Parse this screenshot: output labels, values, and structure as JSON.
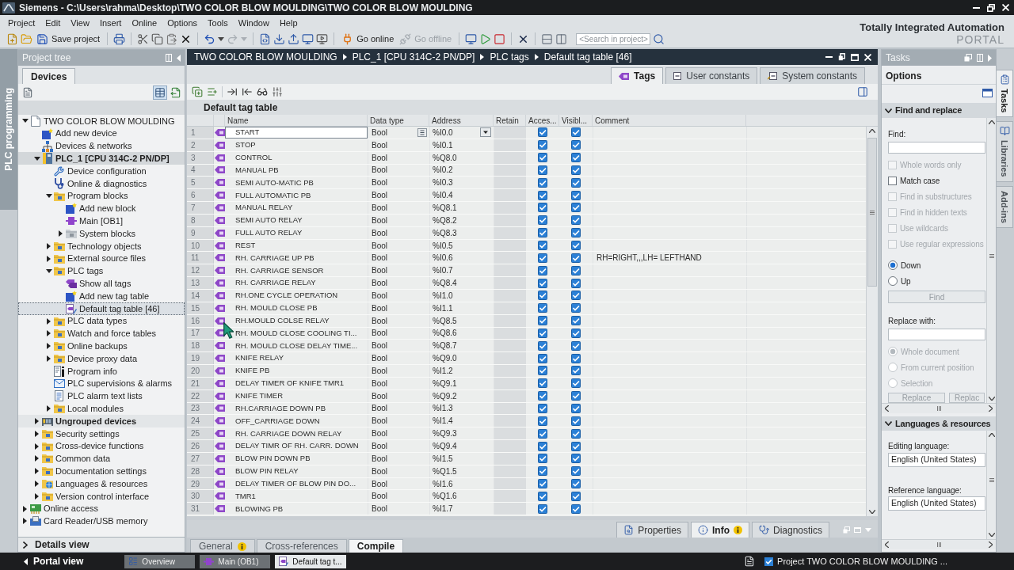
{
  "title_bar": {
    "title": "Siemens - C:\\Users\\rahma\\Desktop\\TWO COLOR BLOW MOULDING\\TWO COLOR BLOW MOULDING"
  },
  "menu": [
    "Project",
    "Edit",
    "View",
    "Insert",
    "Online",
    "Options",
    "Tools",
    "Window",
    "Help"
  ],
  "brand": {
    "line_1": "Totally Integrated Automation",
    "line_2": "PORTAL"
  },
  "toolbar": {
    "save": {
      "label": "Save project"
    },
    "go_online": {
      "label": "Go online",
      "disabled": false
    },
    "go_offline": {
      "label": "Go offline",
      "disabled": true
    },
    "search": {
      "placeholder": "<Search in project>"
    }
  },
  "side_tab": {
    "label": "PLC programming"
  },
  "project_tree": {
    "title": "Project tree",
    "tabs": [
      {
        "label": "Devices",
        "selected": true
      }
    ],
    "items": [
      {
        "label": "TWO COLOR BLOW MOULDING",
        "kind": "project",
        "expanded": true,
        "selected": false,
        "children": [
          {
            "label": "Add new device",
            "kind": "add",
            "selected": false
          },
          {
            "label": "Devices & networks",
            "kind": "network",
            "selected": false
          },
          {
            "label": "PLC_1 [CPU 314C-2 PN/DP]",
            "kind": "cpu",
            "expanded": true,
            "selected": false,
            "children": [
              {
                "label": "Device configuration",
                "kind": "config",
                "selected": false
              },
              {
                "label": "Online & diagnostics",
                "kind": "diagnostics",
                "selected": false
              },
              {
                "label": "Program blocks",
                "kind": "folder",
                "expanded": true,
                "selected": false,
                "children": [
                  {
                    "label": "Add new block",
                    "kind": "add",
                    "selected": false
                  },
                  {
                    "label": "Main [OB1]",
                    "kind": "block",
                    "selected": false
                  },
                  {
                    "label": "System blocks",
                    "kind": "system_folder",
                    "expanded": false,
                    "selected": false
                  }
                ]
              },
              {
                "label": "Technology objects",
                "kind": "folder",
                "expanded": false,
                "selected": false
              },
              {
                "label": "External source files",
                "kind": "folder",
                "expanded": false,
                "selected": false
              },
              {
                "label": "PLC tags",
                "kind": "folder",
                "expanded": true,
                "selected": false,
                "children": [
                  {
                    "label": "Show all tags",
                    "kind": "tags",
                    "selected": false
                  },
                  {
                    "label": "Add new tag table",
                    "kind": "add",
                    "selected": false
                  },
                  {
                    "label": "Default tag table [46]",
                    "kind": "table",
                    "selected": true
                  }
                ]
              },
              {
                "label": "PLC data types",
                "kind": "folder",
                "expanded": false,
                "selected": false
              },
              {
                "label": "Watch and force tables",
                "kind": "folder",
                "expanded": false,
                "selected": false
              },
              {
                "label": "Online backups",
                "kind": "folder",
                "expanded": false,
                "selected": false
              },
              {
                "label": "Device proxy data",
                "kind": "folder",
                "expanded": false,
                "selected": false
              },
              {
                "label": "Program info",
                "kind": "info",
                "selected": false
              },
              {
                "label": "PLC supervisions & alarms",
                "kind": "alarm",
                "selected": false
              },
              {
                "label": "PLC alarm text lists",
                "kind": "list",
                "selected": false
              },
              {
                "label": "Local modules",
                "kind": "folder",
                "expanded": false,
                "selected": false
              }
            ]
          },
          {
            "label": "Ungrouped devices",
            "kind": "devices",
            "expanded": false,
            "selected": false
          },
          {
            "label": "Security settings",
            "kind": "folder",
            "expanded": false,
            "selected": false
          },
          {
            "label": "Cross-device functions",
            "kind": "folder",
            "expanded": false,
            "selected": false
          },
          {
            "label": "Common data",
            "kind": "folder",
            "expanded": false,
            "selected": false
          },
          {
            "label": "Documentation settings",
            "kind": "folder",
            "expanded": false,
            "selected": false
          },
          {
            "label": "Languages & resources",
            "kind": "globe",
            "expanded": false,
            "selected": false
          },
          {
            "label": "Version control interface",
            "kind": "folder",
            "expanded": false,
            "selected": false
          }
        ]
      },
      {
        "label": "Online access",
        "kind": "access",
        "expanded": false,
        "selected": false
      },
      {
        "label": "Card Reader/USB memory",
        "kind": "card",
        "expanded": false,
        "selected": false
      }
    ],
    "details_view": {
      "label": "Details view",
      "expanded": false
    }
  },
  "editor": {
    "breadcrumb": [
      "TWO COLOR BLOW MOULDING",
      "PLC_1 [CPU 314C-2 PN/DP]",
      "PLC tags",
      "Default tag table [46]"
    ],
    "tabs": [
      {
        "label": "Tags",
        "selected": true
      },
      {
        "label": "User constants",
        "selected": false
      },
      {
        "label": "System constants",
        "selected": false
      }
    ],
    "table_title": "Default tag table",
    "table": {
      "columns": [
        "Name",
        "Data type",
        "Address",
        "Retain",
        "Acces...",
        "Visibl...",
        "Comment"
      ],
      "rows": [
        {
          "number": "1",
          "name": "START",
          "data_type": "Bool",
          "address": "%I0.0",
          "accessible": true,
          "visible": true,
          "selected": true
        },
        {
          "number": "2",
          "name": "STOP",
          "data_type": "Bool",
          "address": "%I0.1",
          "accessible": true,
          "visible": true,
          "selected": false
        },
        {
          "number": "3",
          "name": "CONTROL",
          "data_type": "Bool",
          "address": "%Q8.0",
          "accessible": true,
          "visible": true,
          "selected": false
        },
        {
          "number": "4",
          "name": "MANUAL PB",
          "data_type": "Bool",
          "address": "%I0.2",
          "accessible": true,
          "visible": true,
          "selected": false
        },
        {
          "number": "5",
          "name": "SEMI AUTO-MATIC PB",
          "data_type": "Bool",
          "address": "%I0.3",
          "accessible": true,
          "visible": true,
          "selected": false
        },
        {
          "number": "6",
          "name": "FULL AUTOMATIC PB",
          "data_type": "Bool",
          "address": "%I0.4",
          "accessible": true,
          "visible": true,
          "selected": false
        },
        {
          "number": "7",
          "name": "MANUAL RELAY",
          "data_type": "Bool",
          "address": "%Q8.1",
          "accessible": true,
          "visible": true,
          "selected": false
        },
        {
          "number": "8",
          "name": "SEMI AUTO RELAY",
          "data_type": "Bool",
          "address": "%Q8.2",
          "accessible": true,
          "visible": true,
          "selected": false
        },
        {
          "number": "9",
          "name": "FULL AUTO RELAY",
          "data_type": "Bool",
          "address": "%Q8.3",
          "accessible": true,
          "visible": true,
          "selected": false
        },
        {
          "number": "10",
          "name": "REST",
          "data_type": "Bool",
          "address": "%I0.5",
          "accessible": true,
          "visible": true,
          "selected": false
        },
        {
          "number": "11",
          "name": "RH. CARRIAGE UP PB",
          "data_type": "Bool",
          "address": "%I0.6",
          "accessible": true,
          "visible": true,
          "comment": "RH=RIGHT,,,LH= LEFTHAND",
          "selected": false
        },
        {
          "number": "12",
          "name": "RH. CARRIAGE SENSOR",
          "data_type": "Bool",
          "address": "%I0.7",
          "accessible": true,
          "visible": true,
          "selected": false
        },
        {
          "number": "13",
          "name": "RH. CARRIAGE RELAY",
          "data_type": "Bool",
          "address": "%Q8.4",
          "accessible": true,
          "visible": true,
          "selected": false
        },
        {
          "number": "14",
          "name": "RH.ONE CYCLE OPERATION",
          "data_type": "Bool",
          "address": "%I1.0",
          "accessible": true,
          "visible": true,
          "selected": false
        },
        {
          "number": "15",
          "name": "RH. MOULD CLOSE PB",
          "data_type": "Bool",
          "address": "%I1.1",
          "accessible": true,
          "visible": true,
          "selected": false
        },
        {
          "number": "16",
          "name": "RH.MOULD COLSE RELAY",
          "data_type": "Bool",
          "address": "%Q8.5",
          "accessible": true,
          "visible": true,
          "selected": false
        },
        {
          "number": "17",
          "name": "RH. MOULD CLOSE COOLING TI...",
          "data_type": "Bool",
          "address": "%Q8.6",
          "accessible": true,
          "visible": true,
          "selected": false
        },
        {
          "number": "18",
          "name": "RH. MOULD CLOSE DELAY TIME...",
          "data_type": "Bool",
          "address": "%Q8.7",
          "accessible": true,
          "visible": true,
          "selected": false
        },
        {
          "number": "19",
          "name": "KNIFE RELAY",
          "data_type": "Bool",
          "address": "%Q9.0",
          "accessible": true,
          "visible": true,
          "selected": false
        },
        {
          "number": "20",
          "name": "KNIFE PB",
          "data_type": "Bool",
          "address": "%I1.2",
          "accessible": true,
          "visible": true,
          "selected": false
        },
        {
          "number": "21",
          "name": "DELAY TIMER OF KNIFE TMR1",
          "data_type": "Bool",
          "address": "%Q9.1",
          "accessible": true,
          "visible": true,
          "selected": false
        },
        {
          "number": "22",
          "name": "KNIFE TIMER",
          "data_type": "Bool",
          "address": "%Q9.2",
          "accessible": true,
          "visible": true,
          "selected": false
        },
        {
          "number": "23",
          "name": "RH.CARRIAGE DOWN PB",
          "data_type": "Bool",
          "address": "%I1.3",
          "accessible": true,
          "visible": true,
          "selected": false
        },
        {
          "number": "24",
          "name": "OFF_CARRIAGE DOWN",
          "data_type": "Bool",
          "address": "%I1.4",
          "accessible": true,
          "visible": true,
          "selected": false
        },
        {
          "number": "25",
          "name": "RH. CARRIAGE DOWN RELAY",
          "data_type": "Bool",
          "address": "%Q9.3",
          "accessible": true,
          "visible": true,
          "selected": false
        },
        {
          "number": "26",
          "name": "DELAY TIMR OF RH. CARR. DOWN",
          "data_type": "Bool",
          "address": "%Q9.4",
          "accessible": true,
          "visible": true,
          "selected": false
        },
        {
          "number": "27",
          "name": "BLOW PIN DOWN PB",
          "data_type": "Bool",
          "address": "%I1.5",
          "accessible": true,
          "visible": true,
          "selected": false
        },
        {
          "number": "28",
          "name": "BLOW PIN RELAY",
          "data_type": "Bool",
          "address": "%Q1.5",
          "accessible": true,
          "visible": true,
          "selected": false
        },
        {
          "number": "29",
          "name": "DELAY TIMER OF BLOW PIN DO...",
          "data_type": "Bool",
          "address": "%I1.6",
          "accessible": true,
          "visible": true,
          "selected": false
        },
        {
          "number": "30",
          "name": "TMR1",
          "data_type": "Bool",
          "address": "%Q1.6",
          "accessible": true,
          "visible": true,
          "selected": false
        },
        {
          "number": "31",
          "name": "BLOWING PB",
          "data_type": "Bool",
          "address": "%I1.7",
          "accessible": true,
          "visible": true,
          "selected": false
        }
      ]
    },
    "inspector": {
      "tabs": [
        {
          "label": "Properties",
          "selected": false,
          "notice": false
        },
        {
          "label": "Info",
          "selected": true,
          "notice": true
        },
        {
          "label": "Diagnostics",
          "selected": false,
          "notice": false
        }
      ],
      "subtabs": [
        {
          "label": "General",
          "selected": false,
          "notice": true
        },
        {
          "label": "Cross-references",
          "selected": false,
          "notice": false
        },
        {
          "label": "Compile",
          "selected": true,
          "notice": false
        }
      ]
    }
  },
  "tasks": {
    "title": "Tasks",
    "options_title": "Options",
    "find_replace": {
      "title": "Find and replace",
      "expanded": true,
      "find_label": "Find:",
      "options": [
        {
          "label": "Whole words only",
          "checked": false,
          "disabled": true
        },
        {
          "label": "Match case",
          "checked": false,
          "disabled": false
        },
        {
          "label": "Find in substructures",
          "checked": false,
          "disabled": true
        },
        {
          "label": "Find in hidden texts",
          "checked": false,
          "disabled": true
        },
        {
          "label": "Use wildcards",
          "checked": false,
          "disabled": true
        },
        {
          "label": "Use regular expressions",
          "checked": false,
          "disabled": true
        }
      ],
      "direction": [
        {
          "label": "Down",
          "selected": true
        },
        {
          "label": "Up",
          "selected": false
        }
      ],
      "find_button": {
        "label": "Find",
        "disabled": true
      },
      "replace_label": "Replace with:",
      "scope": [
        {
          "label": "Whole document",
          "selected": true,
          "disabled": true
        },
        {
          "label": "From current position",
          "selected": false,
          "disabled": true
        },
        {
          "label": "Selection",
          "selected": false,
          "disabled": true
        }
      ],
      "replace_buttons": [
        {
          "label": "Replace",
          "disabled": true
        },
        {
          "label": "Replac",
          "disabled": true
        }
      ]
    },
    "languages": {
      "title": "Languages & resources",
      "expanded": true,
      "editing_label": "Editing language:",
      "editing_value": "English (United States)",
      "reference_label": "Reference language:",
      "reference_value": "English (United States)"
    }
  },
  "side_tabs": [
    {
      "label": "Tasks",
      "selected": true
    },
    {
      "label": "Libraries",
      "selected": false
    },
    {
      "label": "Add-ins",
      "selected": false
    }
  ],
  "taskbar": {
    "portal_view": "Portal view",
    "windows": [
      {
        "label": "Overview",
        "kind": "overview",
        "selected": false
      },
      {
        "label": "Main (OB1)",
        "kind": "block",
        "selected": false
      },
      {
        "label": "Default tag t...",
        "kind": "table",
        "selected": true
      }
    ],
    "status": "Project TWO COLOR BLOW MOULDING ..."
  }
}
